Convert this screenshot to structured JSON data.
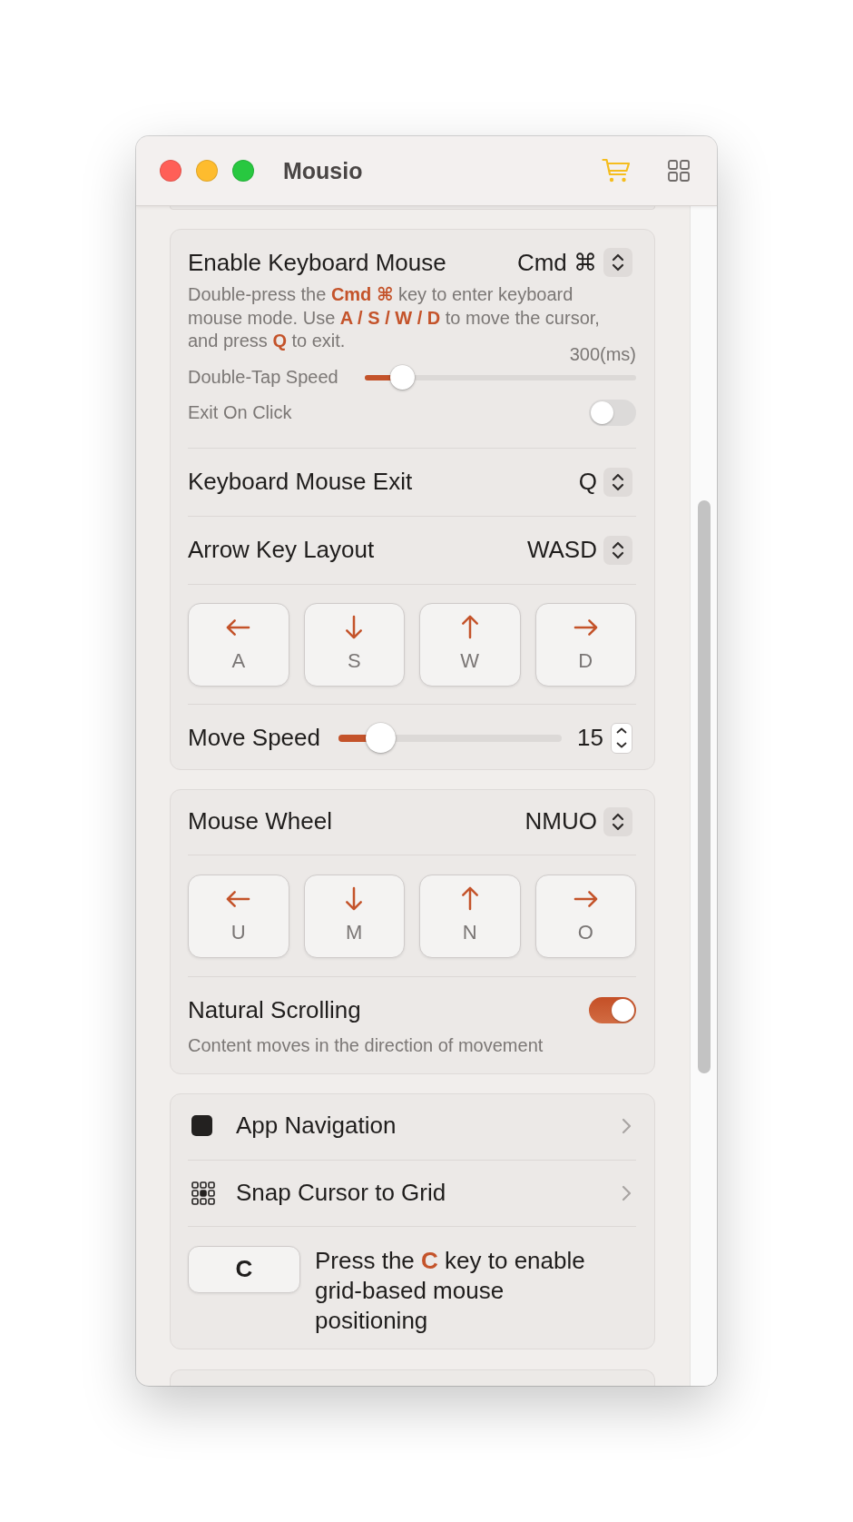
{
  "window": {
    "title": "Mousio"
  },
  "keyboard_mouse": {
    "label": "Enable Keyboard Mouse",
    "shortcut": "Cmd ⌘",
    "description": "Double-press the **Cmd ⌘** key to enter keyboard mouse mode. Use **A / S / W / D** to move the cursor, and press **Q** to exit.",
    "double_tap_speed": {
      "label": "Double-Tap Speed",
      "reading": "300(ms)",
      "level": 0.14
    },
    "exit_on_click": {
      "label": "Exit On Click",
      "on": false
    },
    "exit_key": {
      "label": "Keyboard Mouse Exit",
      "value": "Q"
    },
    "arrow_key_layout": {
      "label": "Arrow Key Layout",
      "value": "WASD"
    },
    "keys": [
      {
        "kind": "left",
        "key": "A"
      },
      {
        "kind": "down",
        "key": "S"
      },
      {
        "kind": "up",
        "key": "W"
      },
      {
        "kind": "right",
        "key": "D"
      }
    ],
    "move_speed": {
      "label": "Move Speed",
      "level": 0.19,
      "value": "15"
    }
  },
  "mouse_wheel": {
    "label": "Mouse Wheel",
    "value": "NMUO",
    "keys": [
      {
        "kind": "left",
        "key": "U"
      },
      {
        "kind": "down",
        "key": "M"
      },
      {
        "kind": "up",
        "key": "N"
      },
      {
        "kind": "right",
        "key": "O"
      }
    ],
    "natural_scrolling": {
      "label": "Natural Scrolling",
      "on": true,
      "description": "Content moves in the direction of movement"
    }
  },
  "navigation": {
    "items": [
      {
        "kind": "square",
        "label": "App Navigation"
      },
      {
        "kind": "grid",
        "label": "Snap Cursor to Grid"
      }
    ],
    "grid_hint": {
      "key": "C",
      "text": "Press the **C** key to enable grid-based mouse positioning"
    }
  }
}
